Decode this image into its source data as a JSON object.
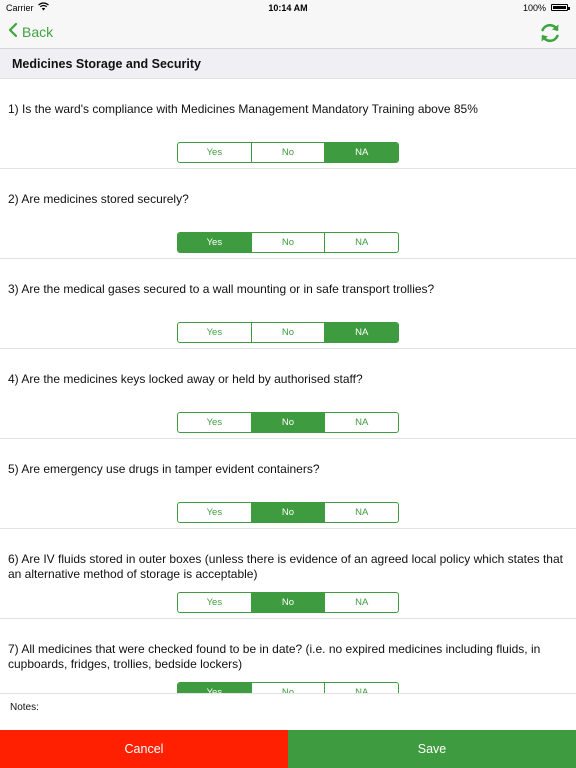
{
  "status_bar": {
    "carrier": "Carrier",
    "time": "10:14 AM",
    "battery": "100%"
  },
  "nav": {
    "back_label": "Back",
    "back_icon": "chevron-left-icon",
    "refresh_icon": "refresh-icon",
    "accent_color": "#3fa33f"
  },
  "section": {
    "title": "Medicines Storage and Security"
  },
  "questions": [
    {
      "text": "1) Is the ward's compliance with Medicines Management Mandatory Training above 85%",
      "options": [
        "Yes",
        "No",
        "NA"
      ],
      "selected": "NA"
    },
    {
      "text": "2) Are medicines stored securely?",
      "options": [
        "Yes",
        "No",
        "NA"
      ],
      "selected": "Yes"
    },
    {
      "text": "3) Are the medical gases secured to a wall mounting or in safe transport trollies?",
      "options": [
        "Yes",
        "No",
        "NA"
      ],
      "selected": "NA"
    },
    {
      "text": "4) Are the medicines keys locked away or held by authorised staff?",
      "options": [
        "Yes",
        "No",
        "NA"
      ],
      "selected": "No"
    },
    {
      "text": "5) Are emergency use drugs in tamper evident containers?",
      "options": [
        "Yes",
        "No",
        "NA"
      ],
      "selected": "No"
    },
    {
      "text": "6) Are IV fluids stored in outer boxes (unless there is evidence of an agreed local policy which states that an alternative method of storage is acceptable)",
      "options": [
        "Yes",
        "No",
        "NA"
      ],
      "selected": "No"
    },
    {
      "text": "7) All medicines that were checked found to be in date? (i.e. no expired medicines including fluids, in cupboards, fridges, trollies, bedside lockers)",
      "options": [
        "Yes",
        "No",
        "NA"
      ],
      "selected": "Yes"
    }
  ],
  "notes": {
    "label": "Notes:"
  },
  "footer": {
    "cancel_label": "Cancel",
    "save_label": "Save",
    "cancel_color": "#fe2000",
    "save_color": "#3f9b3f"
  }
}
